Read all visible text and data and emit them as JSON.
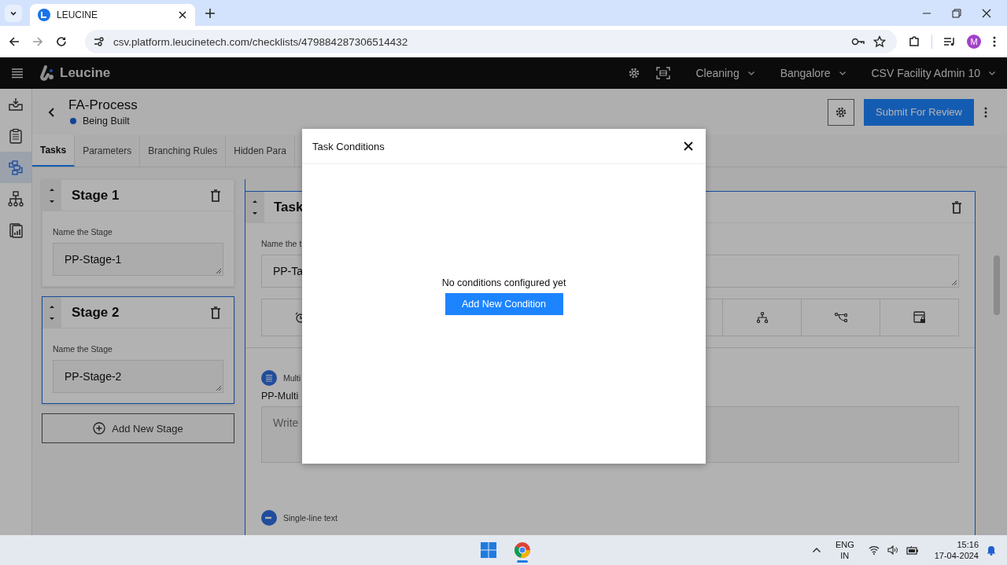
{
  "browser": {
    "tab_title": "LEUCINE",
    "url": "csv.platform.leucinetech.com/checklists/479884287306514432",
    "profile_initial": "M"
  },
  "header": {
    "brand": "Leucine",
    "menus": [
      {
        "label": "Cleaning"
      },
      {
        "label": "Bangalore"
      },
      {
        "label": "CSV Facility Admin 10"
      }
    ]
  },
  "rail": [
    {
      "kind": "inbox",
      "selected": false
    },
    {
      "kind": "clipboard",
      "selected": false
    },
    {
      "kind": "flow",
      "selected": true
    },
    {
      "kind": "hierarchy",
      "selected": false
    },
    {
      "kind": "report",
      "selected": false
    }
  ],
  "page": {
    "title": "FA-Process",
    "status": "Being Built",
    "submit_button": "Submit For Review"
  },
  "tabs": [
    {
      "label": "Tasks",
      "selected": true
    },
    {
      "label": "Parameters",
      "selected": false
    },
    {
      "label": "Branching Rules",
      "selected": false
    },
    {
      "label": "Hidden Para",
      "selected": false
    }
  ],
  "stages": [
    {
      "title": "Stage 1",
      "field_label": "Name the Stage",
      "value": "PP-Stage-1",
      "selected": false
    },
    {
      "title": "Stage 2",
      "field_label": "Name the Stage",
      "value": "PP-Stage-2",
      "selected": true
    }
  ],
  "add_stage": "Add New Stage",
  "task": {
    "title": "Task",
    "field_label": "Name the t",
    "value": "PP-Ta",
    "toolbar": [
      {
        "kind": "alarm"
      },
      {
        "kind": "branch"
      },
      {
        "kind": "route"
      },
      {
        "kind": "lock"
      }
    ],
    "parameters": [
      {
        "kind": "multi",
        "type_label": "Multi",
        "name": "PP-Multi",
        "placeholder": "Write"
      },
      {
        "kind": "single",
        "type_label": "Single-line text"
      }
    ]
  },
  "modal": {
    "title": "Task Conditions",
    "empty_text": "No conditions configured yet",
    "button": "Add New Condition"
  },
  "taskbar": {
    "language": "ENG",
    "region": "IN",
    "time": "15:16",
    "date": "17-04-2024"
  }
}
